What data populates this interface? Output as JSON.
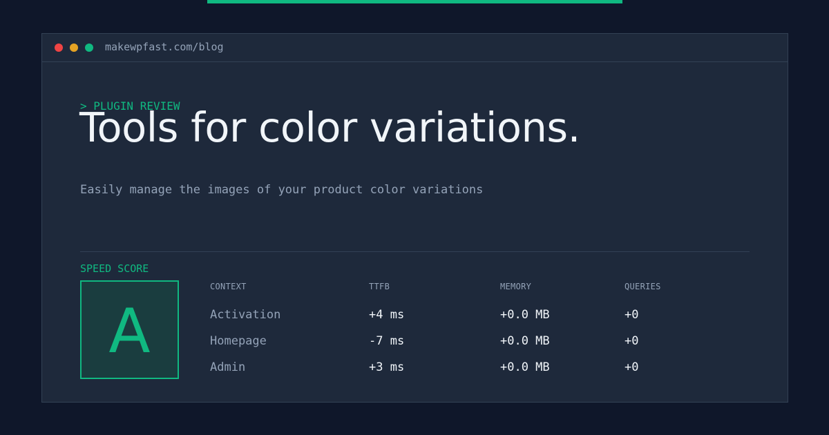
{
  "browser": {
    "url": "makewpfast.com/blog"
  },
  "article": {
    "eyebrow": "> PLUGIN REVIEW",
    "title": "Tools for color variations.",
    "subtitle": "Easily manage the images of your product color variations"
  },
  "speed": {
    "label": "SPEED SCORE",
    "grade": "A"
  },
  "table": {
    "headers": [
      "CONTEXT",
      "TTFB",
      "MEMORY",
      "QUERIES"
    ],
    "rows": [
      [
        "Activation",
        "+4 ms",
        "+0.0 MB",
        "+0"
      ],
      [
        "Homepage",
        "-7 ms",
        "+0.0 MB",
        "+0"
      ],
      [
        "Admin",
        "+3 ms",
        "+0.0 MB",
        "+0"
      ]
    ]
  },
  "colors": {
    "accent": "#10b981",
    "background": "#0f172a",
    "card": "#1e293b",
    "text": "#f1f5f9",
    "muted": "#94a3b8",
    "dot_red": "#ef4444",
    "dot_yellow": "#e5a324",
    "dot_green": "#10b981"
  }
}
